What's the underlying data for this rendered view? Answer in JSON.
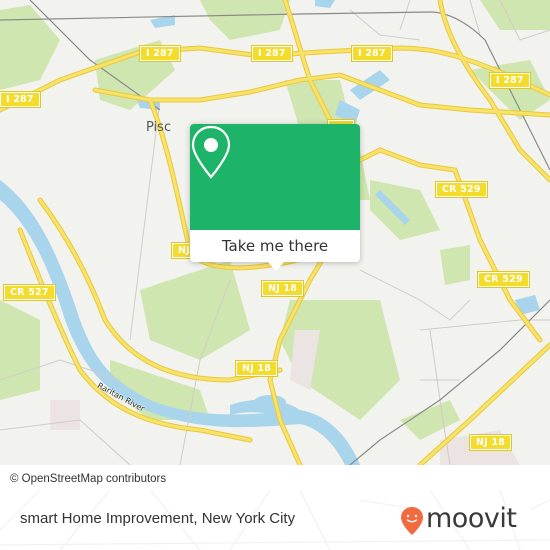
{
  "map": {
    "road_shields": [
      {
        "label": "I 287"
      },
      {
        "label": "I 287"
      },
      {
        "label": "I 287"
      },
      {
        "label": "I 287"
      },
      {
        "label": "I 287"
      },
      {
        "label": "CR 529"
      },
      {
        "label": "CR 529"
      },
      {
        "label": "CR 527"
      },
      {
        "label": "NJ 18"
      },
      {
        "label": "NJ 18"
      },
      {
        "label": "NJ 18"
      },
      {
        "label": "NJ 27"
      },
      {
        "label": "NJ"
      }
    ],
    "place_label": "Pisc",
    "river_label": "Raritan River",
    "colors": {
      "land": "#f2f2ee",
      "park": "#cfe6b0",
      "water": "#a8d4ec",
      "road": "#f7e26b",
      "road_edge": "#e8c93a"
    }
  },
  "popup": {
    "pin_icon": "location-pin-icon",
    "button_label": "Take me there",
    "color": "#1db46a"
  },
  "attribution": "© OpenStreetMap contributors",
  "footer": {
    "place_name": "smart Home Improvement, New York City",
    "brand": "moovit",
    "brand_color": "#f26a3f"
  }
}
